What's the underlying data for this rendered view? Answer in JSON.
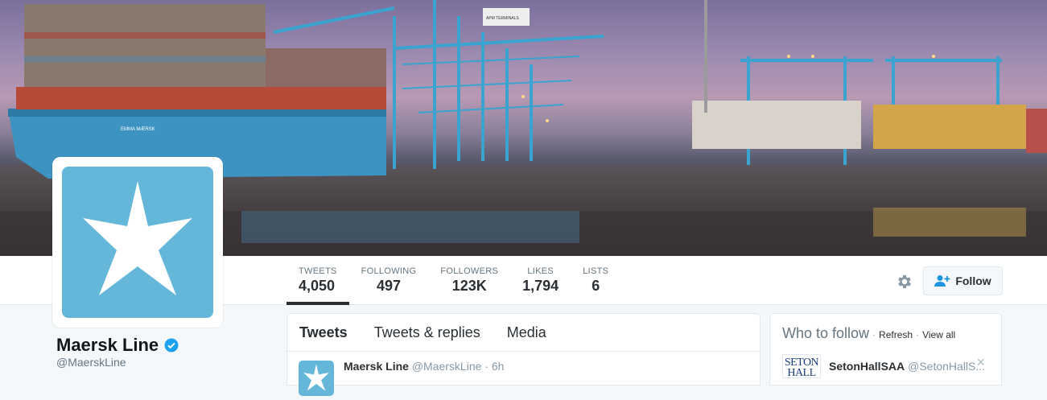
{
  "profile": {
    "name": "Maersk Line",
    "handle": "@MaerskLine",
    "verified": true,
    "brand_color": "#64b7d9"
  },
  "stats": [
    {
      "label": "TWEETS",
      "value": "4,050"
    },
    {
      "label": "FOLLOWING",
      "value": "497"
    },
    {
      "label": "FOLLOWERS",
      "value": "123K"
    },
    {
      "label": "LIKES",
      "value": "1,794"
    },
    {
      "label": "LISTS",
      "value": "6"
    }
  ],
  "actions": {
    "follow_label": "Follow",
    "settings_icon": "gear-icon",
    "follow_icon": "add-user-icon"
  },
  "timeline": {
    "tabs": [
      "Tweets",
      "Tweets & replies",
      "Media"
    ],
    "first_tweet": {
      "name": "Maersk Line",
      "handle": "@MaerskLine",
      "time": "· 6h"
    }
  },
  "who_to_follow": {
    "title": "Who to follow",
    "refresh": "Refresh",
    "view_all": "View all",
    "separator": "·",
    "user": {
      "avatar_text": "SETON HALL",
      "name": "SetonHallSAA",
      "handle": "@SetonHallS..."
    }
  },
  "header_photo": {
    "crane_label": "APM TERMINALS",
    "ship_name": "EMMA MÆRSK"
  }
}
